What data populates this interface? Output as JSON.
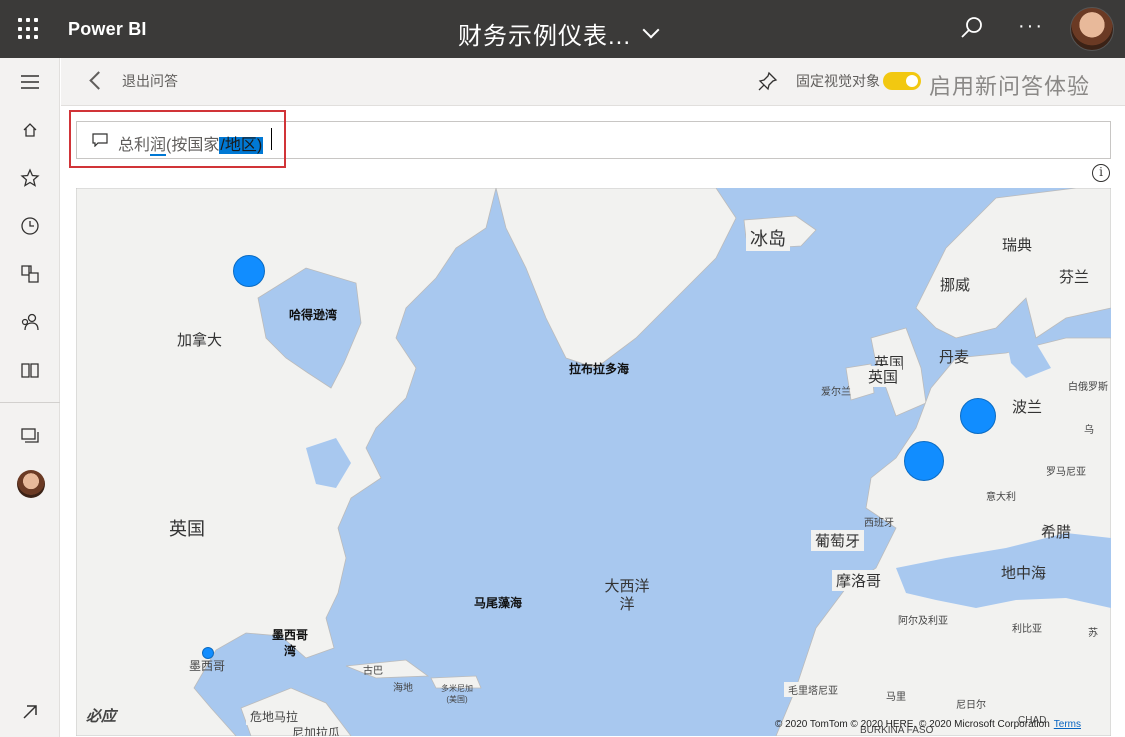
{
  "topbar": {
    "brand": "Power BI",
    "report_title": "财务示例仪表...",
    "more": "···"
  },
  "qa_header": {
    "exit_label": "退出问答",
    "pin_label": "固定视觉对象",
    "new_qa_label": "启用新问答体验",
    "toggle_on": true
  },
  "qa_input": {
    "prefix": "总利",
    "underlined": "润",
    "middle": "(按国家",
    "highlighted": "/地区)"
  },
  "colors": {
    "topbar_bg": "#3b3a39",
    "toggle": "#f2c811",
    "bubble": "#118dff",
    "highlight": "#0078d4",
    "red_box": "#d13438",
    "water": "#a8c8ef",
    "land": "#f2f2f0"
  },
  "map": {
    "labels": {
      "iceland": "冰岛",
      "sweden": "瑞典",
      "finland": "芬兰",
      "norway": "挪威",
      "canada": "加拿大",
      "hudson_bay": "哈得逊湾",
      "labrador_sea": "拉布拉多海",
      "uk_1": "英国",
      "uk_2": "英国",
      "ireland": "爱尔兰",
      "denmark": "丹麦",
      "belarus": "白俄罗斯",
      "poland": "波兰",
      "romania": "罗马尼亚",
      "spain": "西班牙",
      "portugal": "葡萄牙",
      "greece": "希腊",
      "morocco": "摩洛哥",
      "mediterranean": "地中海",
      "algeria": "阿尔及利亚",
      "libya": "利比亚",
      "mauritania": "毛里塔尼亚",
      "mali": "马里",
      "niger": "尼日尔",
      "chad": "CHAD",
      "burkina": "BURKINA FASO",
      "sargasso_sea": "马尾藻海",
      "atlantic_ocean": "大西洋洋",
      "gulf_of_mexico": "墨西哥湾",
      "mexico": "墨西哥",
      "cuba": "古巴",
      "haiti": "海地",
      "dominican": "多米尼加(美国)",
      "guatemala": "危地马拉",
      "nicaragua": "尼加拉瓜",
      "ukraine_partial": "乌",
      "us_label": "英国",
      "bing_logo": "必应",
      "italy_sm": "意大利",
      "sudan_partial": "苏"
    },
    "copyright": "© 2020 TomTom © 2020 HERE, © 2020 Microsoft Corporation",
    "terms": "Terms"
  }
}
